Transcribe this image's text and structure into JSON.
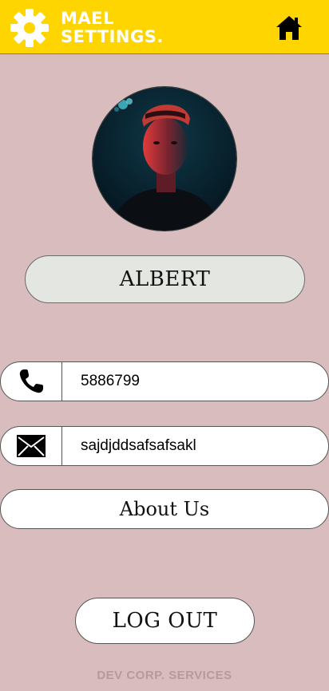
{
  "header": {
    "title_line1": "MAEL",
    "title_line2": "SETTINGS.",
    "background": "#ffd500",
    "title_color": "#ffffff",
    "left_icon": "gear-icon",
    "right_icon": "home-icon"
  },
  "profile": {
    "name": "ALBERT",
    "avatar": "avatar-photo"
  },
  "contact": {
    "phone": {
      "icon": "phone-icon",
      "value": "5886799"
    },
    "email": {
      "icon": "envelope-icon",
      "value": "sajdjddsafsafsakl"
    }
  },
  "actions": {
    "about_label": "About Us",
    "logout_label": "LOG OUT"
  },
  "footer": {
    "text": "DEV CORP. SERVICES"
  },
  "colors": {
    "page_background": "#d9bcbd",
    "name_pill": "#e3e6e1",
    "footer_text": "#b79a9b"
  }
}
